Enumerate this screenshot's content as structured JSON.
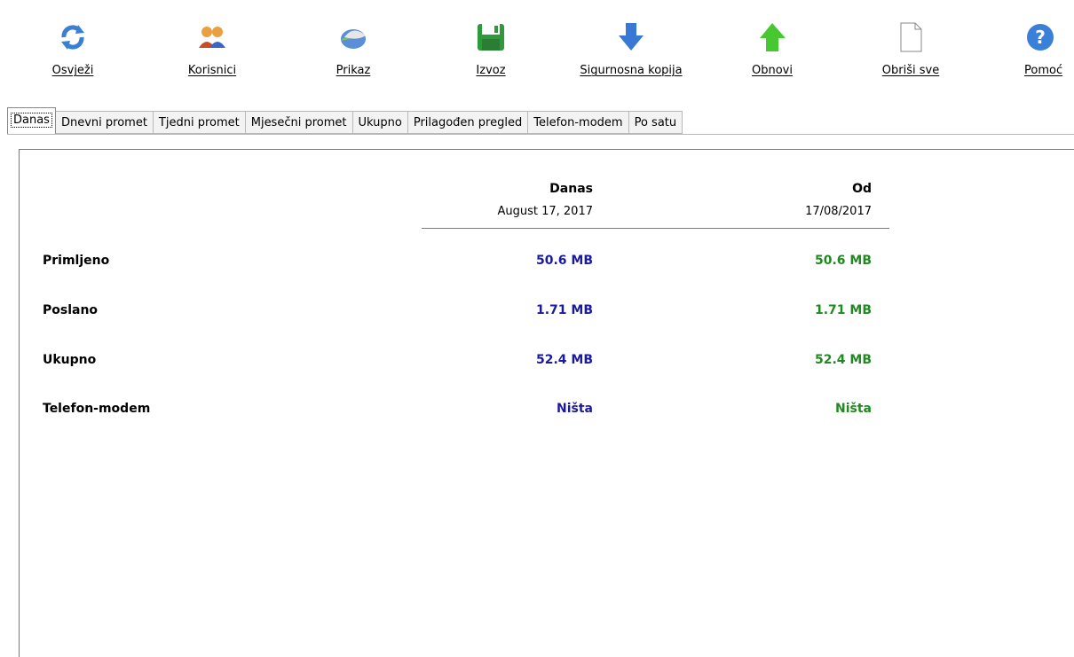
{
  "toolbar": {
    "buttons": [
      {
        "label": "Osvježi",
        "icon": "refresh-icon"
      },
      {
        "label": "Korisnici",
        "icon": "users-icon"
      },
      {
        "label": "Prikaz",
        "icon": "view-icon"
      },
      {
        "label": "Izvoz",
        "icon": "save-icon"
      },
      {
        "label": "Sigurnosna kopija",
        "icon": "arrow-down-icon"
      },
      {
        "label": "Obnovi",
        "icon": "arrow-up-icon"
      },
      {
        "label": "Obriši sve",
        "icon": "blank-page-icon"
      },
      {
        "label": "Pomoć",
        "icon": "help-icon"
      }
    ]
  },
  "tabs": [
    "Danas",
    "Dnevni promet",
    "Tjedni promet",
    "Mjesečni promet",
    "Ukupno",
    "Prilagođen pregled",
    "Telefon-modem",
    "Po satu"
  ],
  "active_tab": "Danas",
  "table": {
    "columns": [
      {
        "title": "Danas",
        "subtitle": "August 17, 2017"
      },
      {
        "title": "Od",
        "subtitle": "17/08/2017"
      }
    ],
    "rows": [
      {
        "label": "Primljeno",
        "values": [
          "50.6 MB",
          "50.6 MB"
        ]
      },
      {
        "label": "Poslano",
        "values": [
          "1.71 MB",
          "1.71 MB"
        ]
      },
      {
        "label": "Ukupno",
        "values": [
          "52.4 MB",
          "52.4 MB"
        ]
      },
      {
        "label": "Telefon-modem",
        "values": [
          "Ništa",
          "Ništa"
        ]
      }
    ]
  },
  "colors": {
    "col1_values": "#1a1aa0",
    "col2_values": "#1f8a1f"
  }
}
